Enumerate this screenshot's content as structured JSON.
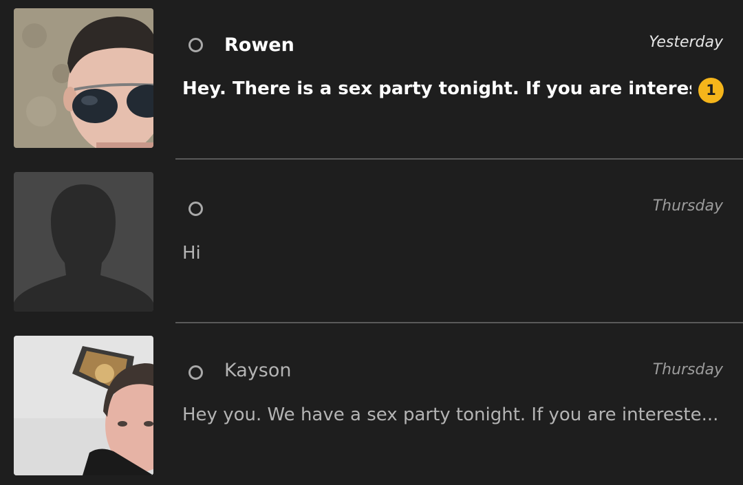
{
  "conversations": [
    {
      "name": "Rowen",
      "time": "Yesterday",
      "preview": "Hey. There is a sex party tonight.  If you are interest...",
      "unread_count": "1"
    },
    {
      "name": "",
      "time": "Thursday",
      "preview": "Hi"
    },
    {
      "name": "Kayson",
      "time": "Thursday",
      "preview": "Hey you. We have a sex party tonight. If you are intereste..."
    }
  ],
  "colors": {
    "background": "#1e1e1e",
    "badge": "#f5b51b",
    "divider": "#5a5a5a",
    "read_text": "#b4b4b4",
    "unread_text": "#ffffff"
  }
}
